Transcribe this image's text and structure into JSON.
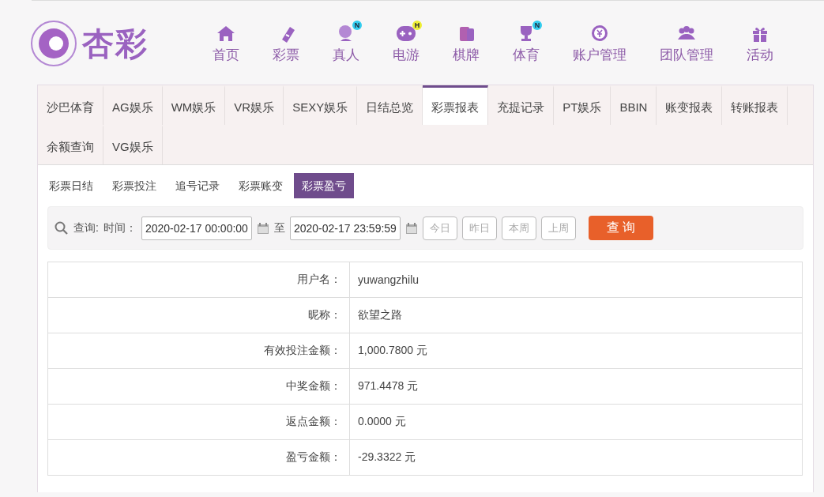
{
  "logo": {
    "text": "杏彩"
  },
  "nav": [
    {
      "label": "首页"
    },
    {
      "label": "彩票"
    },
    {
      "label": "真人",
      "badge": "N",
      "color": "#33ccee"
    },
    {
      "label": "电游",
      "badge": "H",
      "color": "#eeee33"
    },
    {
      "label": "棋牌"
    },
    {
      "label": "体育",
      "badge": "N",
      "color": "#33ccee"
    },
    {
      "label": "账户管理"
    },
    {
      "label": "团队管理"
    },
    {
      "label": "活动"
    }
  ],
  "tabs": [
    {
      "label": "沙巴体育",
      "selected": false
    },
    {
      "label": "AG娱乐",
      "selected": false
    },
    {
      "label": "WM娱乐",
      "selected": false
    },
    {
      "label": "VR娱乐",
      "selected": false
    },
    {
      "label": "SEXY娱乐",
      "selected": false
    },
    {
      "label": "日结总览",
      "selected": false
    },
    {
      "label": "彩票报表",
      "selected": true
    },
    {
      "label": "充提记录",
      "selected": false
    },
    {
      "label": "PT娱乐",
      "selected": false
    },
    {
      "label": "BBIN",
      "selected": false
    },
    {
      "label": "账变报表",
      "selected": false
    },
    {
      "label": "转账报表",
      "selected": false
    },
    {
      "label": "余额查询",
      "selected": false
    },
    {
      "label": "VG娱乐",
      "selected": false
    }
  ],
  "subtabs": [
    {
      "label": "彩票日结",
      "selected": false
    },
    {
      "label": "彩票投注",
      "selected": false
    },
    {
      "label": "追号记录",
      "selected": false
    },
    {
      "label": "彩票账变",
      "selected": false
    },
    {
      "label": "彩票盈亏",
      "selected": true
    }
  ],
  "query": {
    "label": "查询:",
    "time_label": "时间：",
    "start": "2020-02-17 00:00:00",
    "to": "至",
    "end": "2020-02-17 23:59:59",
    "quick": [
      "今日",
      "昨日",
      "本周",
      "上周"
    ],
    "submit": "查 询"
  },
  "rows": [
    {
      "label": "用户名：",
      "value": "yuwangzhilu"
    },
    {
      "label": "昵称：",
      "value": "欲望之路"
    },
    {
      "label": "有效投注金额：",
      "value": "1,000.7800 元"
    },
    {
      "label": "中奖金额：",
      "value": "971.4478 元"
    },
    {
      "label": "返点金额：",
      "value": "0.0000 元"
    },
    {
      "label": "盈亏金额：",
      "value": "-29.3322 元"
    }
  ]
}
